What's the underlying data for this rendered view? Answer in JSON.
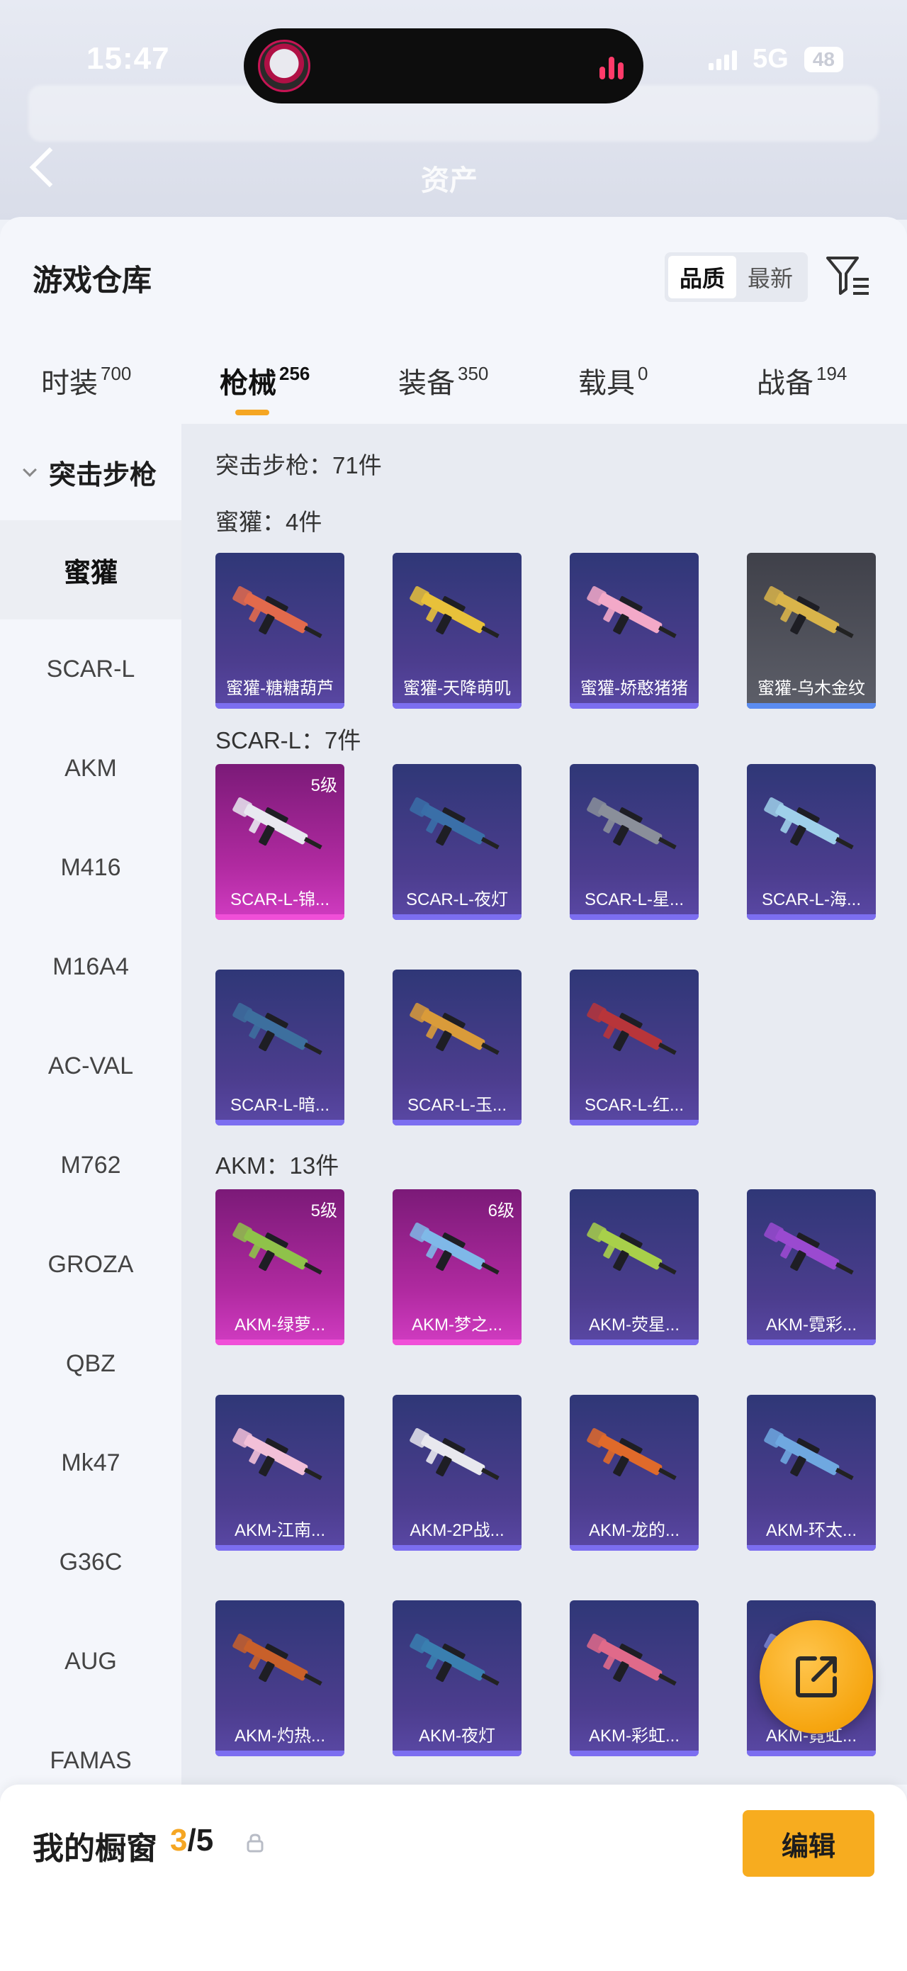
{
  "status_bar": {
    "time": "15:47",
    "network": "5G",
    "battery": "48"
  },
  "header_bg": {
    "tab_label": "资产"
  },
  "sheet": {
    "title": "游戏仓库"
  },
  "sort": {
    "options": [
      "品质",
      "最新"
    ],
    "selected": "品质"
  },
  "categories": [
    {
      "label": "时装",
      "count": "700"
    },
    {
      "label": "枪械",
      "count": "256"
    },
    {
      "label": "装备",
      "count": "350"
    },
    {
      "label": "载具",
      "count": "0"
    },
    {
      "label": "战备",
      "count": "194"
    }
  ],
  "selected_category": "枪械",
  "sidebar": {
    "group": "突击步枪",
    "items": [
      "蜜獾",
      "SCAR-L",
      "AKM",
      "M416",
      "M16A4",
      "AC-VAL",
      "M762",
      "GROZA",
      "QBZ",
      "Mk47",
      "G36C",
      "AUG",
      "FAMAS"
    ],
    "selected": "蜜獾"
  },
  "content": {
    "group_total": "突击步枪：71件",
    "sections": [
      {
        "title": "蜜獾：4件",
        "items": [
          {
            "name": "蜜獾-糖糖葫芦",
            "style": "purple",
            "gun_color": "#e26a4c"
          },
          {
            "name": "蜜獾-天降萌叽",
            "style": "purple",
            "gun_color": "#e8c13a"
          },
          {
            "name": "蜜獾-娇憨猪猪",
            "style": "purple",
            "gun_color": "#f3a9c8"
          },
          {
            "name": "蜜獾-乌木金纹",
            "style": "grey",
            "gun_color": "#d9b44a"
          }
        ]
      },
      {
        "title": "SCAR-L：7件",
        "items": [
          {
            "name": "SCAR-L-锦...",
            "style": "pink",
            "level": "5级",
            "gun_color": "#e8e8f0"
          },
          {
            "name": "SCAR-L-夜灯",
            "style": "purple",
            "gun_color": "#3a6fa8"
          },
          {
            "name": "SCAR-L-星...",
            "style": "purple",
            "gun_color": "#8a8f9a"
          },
          {
            "name": "SCAR-L-海...",
            "style": "purple",
            "gun_color": "#9fd0ea"
          },
          {
            "name": "SCAR-L-暗...",
            "style": "purple",
            "gun_color": "#3d6f9e"
          },
          {
            "name": "SCAR-L-玉...",
            "style": "purple",
            "gun_color": "#d99b3a"
          },
          {
            "name": "SCAR-L-红...",
            "style": "purple",
            "gun_color": "#b8353a"
          }
        ]
      },
      {
        "title": "AKM：13件",
        "items": [
          {
            "name": "AKM-绿萝...",
            "style": "pink",
            "level": "5级",
            "gun_color": "#8fc24a"
          },
          {
            "name": "AKM-梦之...",
            "style": "pink",
            "level": "6级",
            "gun_color": "#7fb8e8"
          },
          {
            "name": "AKM-荧星...",
            "style": "purple",
            "gun_color": "#a8d04a"
          },
          {
            "name": "AKM-霓彩...",
            "style": "purple",
            "gun_color": "#9a4ad0"
          },
          {
            "name": "AKM-江南...",
            "style": "purple",
            "gun_color": "#f2c0d8"
          },
          {
            "name": "AKM-2P战...",
            "style": "purple",
            "gun_color": "#e8e8ee"
          },
          {
            "name": "AKM-龙的...",
            "style": "purple",
            "gun_color": "#e06a2a"
          },
          {
            "name": "AKM-环太...",
            "style": "purple",
            "gun_color": "#6fa8e0"
          },
          {
            "name": "AKM-灼热...",
            "style": "purple",
            "gun_color": "#c8602a"
          },
          {
            "name": "AKM-夜灯",
            "style": "purple",
            "gun_color": "#3a7fb0"
          },
          {
            "name": "AKM-彩虹...",
            "style": "purple",
            "gun_color": "#e06a8a"
          },
          {
            "name": "AKM-霓虹...",
            "style": "purple",
            "gun_color": "#7f8ad8"
          }
        ]
      }
    ]
  },
  "showcase": {
    "label": "我的橱窗",
    "current": "3",
    "total": "/5",
    "edit_label": "编辑"
  },
  "colors": {
    "accent": "#f5a623",
    "card_purple": "#3c3f85",
    "card_pink": "#b02aa0"
  }
}
